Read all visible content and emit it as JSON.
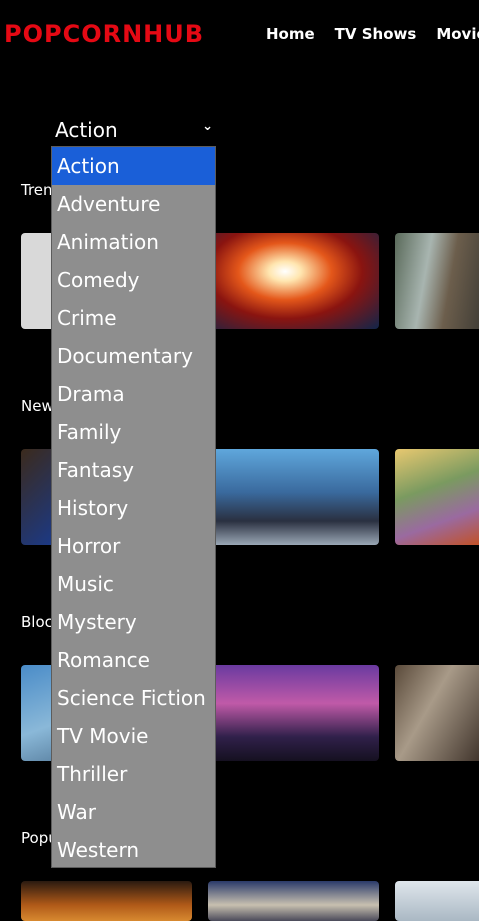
{
  "header": {
    "logo": "POPCORNHUB",
    "brand_color": "#e50914",
    "nav": [
      "Home",
      "TV Shows",
      "Movies"
    ]
  },
  "genre_select": {
    "selected": "Action",
    "icon": "chevron-down-icon",
    "options": [
      "Action",
      "Adventure",
      "Animation",
      "Comedy",
      "Crime",
      "Documentary",
      "Drama",
      "Family",
      "Fantasy",
      "History",
      "Horror",
      "Music",
      "Mystery",
      "Romance",
      "Science Fiction",
      "TV Movie",
      "Thriller",
      "War",
      "Western"
    ]
  },
  "sections": [
    {
      "title": "Tren"
    },
    {
      "title": "New"
    },
    {
      "title": "Bloc"
    },
    {
      "title": "Popu"
    }
  ]
}
